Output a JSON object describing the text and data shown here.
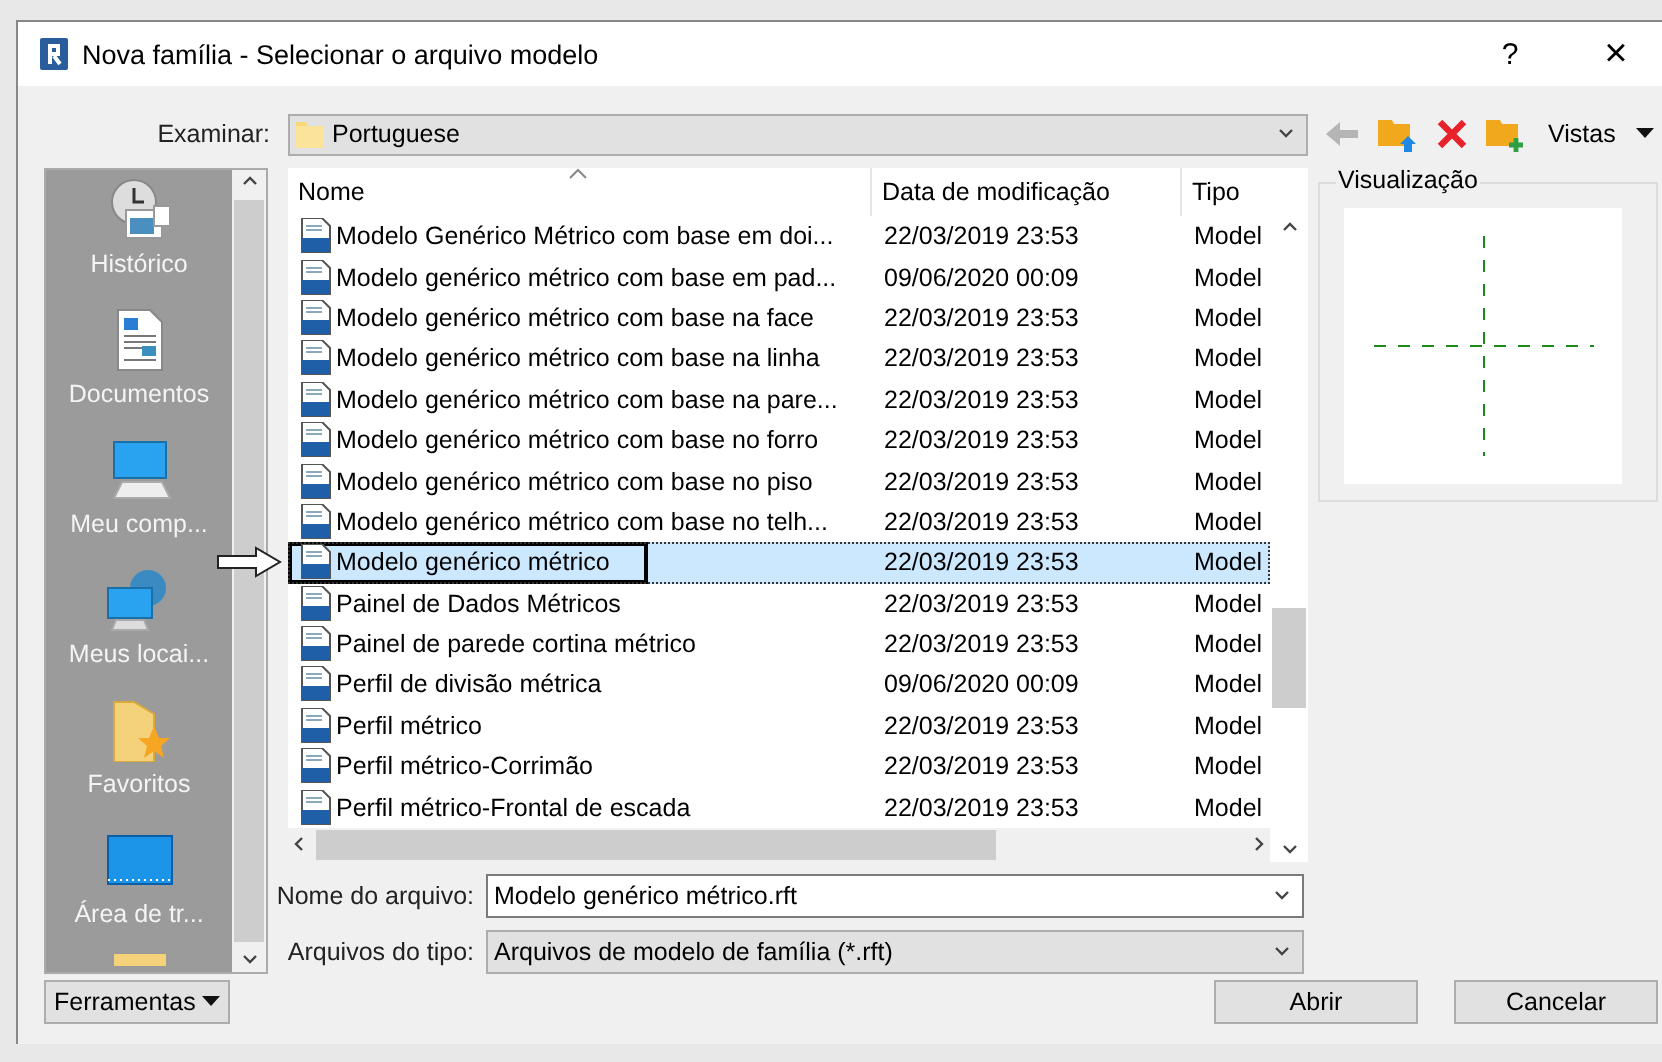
{
  "window": {
    "title": "Nova família - Selecionar o arquivo modelo",
    "help": "?",
    "close": "×"
  },
  "look_in": {
    "label": "Examinar:",
    "value": "Portuguese"
  },
  "toolbar": {
    "views": "Vistas"
  },
  "sidebar": {
    "items": [
      {
        "kind": "history",
        "label": "Histórico"
      },
      {
        "kind": "documents",
        "label": "Documentos"
      },
      {
        "kind": "computer",
        "label": "Meu comp..."
      },
      {
        "kind": "network",
        "label": "Meus locai..."
      },
      {
        "kind": "favorites",
        "label": "Favoritos"
      },
      {
        "kind": "desktop",
        "label": "Área de tr..."
      }
    ]
  },
  "file_list": {
    "columns": [
      "Nome",
      "Data de modificação",
      "Tipo"
    ],
    "rows": [
      {
        "name": "Modelo Genérico Métrico com base em doi...",
        "date": "22/03/2019 23:53",
        "type": "Model",
        "selected": false,
        "marked": false
      },
      {
        "name": "Modelo genérico métrico com base em pad...",
        "date": "09/06/2020 00:09",
        "type": "Model",
        "selected": false,
        "marked": false
      },
      {
        "name": "Modelo genérico métrico com base na face",
        "date": "22/03/2019 23:53",
        "type": "Model",
        "selected": false,
        "marked": false
      },
      {
        "name": "Modelo genérico métrico com base na linha",
        "date": "22/03/2019 23:53",
        "type": "Model",
        "selected": false,
        "marked": false
      },
      {
        "name": "Modelo genérico métrico com base na pare...",
        "date": "22/03/2019 23:53",
        "type": "Model",
        "selected": false,
        "marked": false
      },
      {
        "name": "Modelo genérico métrico com base no forro",
        "date": "22/03/2019 23:53",
        "type": "Model",
        "selected": false,
        "marked": false
      },
      {
        "name": "Modelo genérico métrico com base no piso",
        "date": "22/03/2019 23:53",
        "type": "Model",
        "selected": false,
        "marked": false
      },
      {
        "name": "Modelo genérico métrico com base no telh...",
        "date": "22/03/2019 23:53",
        "type": "Model",
        "selected": false,
        "marked": false
      },
      {
        "name": "Modelo genérico métrico",
        "date": "22/03/2019 23:53",
        "type": "Model",
        "selected": true,
        "marked": true
      },
      {
        "name": "Painel de Dados Métricos",
        "date": "22/03/2019 23:53",
        "type": "Model",
        "selected": false,
        "marked": false
      },
      {
        "name": "Painel de parede cortina métrico",
        "date": "22/03/2019 23:53",
        "type": "Model",
        "selected": false,
        "marked": false
      },
      {
        "name": "Perfil de divisão métrica",
        "date": "09/06/2020 00:09",
        "type": "Model",
        "selected": false,
        "marked": false
      },
      {
        "name": "Perfil métrico",
        "date": "22/03/2019 23:53",
        "type": "Model",
        "selected": false,
        "marked": false
      },
      {
        "name": "Perfil métrico-Corrimão",
        "date": "22/03/2019 23:53",
        "type": "Model",
        "selected": false,
        "marked": false
      },
      {
        "name": "Perfil métrico-Frontal de escada",
        "date": "22/03/2019 23:53",
        "type": "Model",
        "selected": false,
        "marked": false
      }
    ]
  },
  "preview": {
    "title": "Visualização"
  },
  "file_name": {
    "label": "Nome do arquivo:",
    "value": "Modelo genérico métrico.rft"
  },
  "file_type": {
    "label": "Arquivos do tipo:",
    "value": "Arquivos de modelo de família  (*.rft)"
  },
  "buttons": {
    "tools": "Ferramentas",
    "open": "Abrir",
    "cancel": "Cancelar"
  }
}
